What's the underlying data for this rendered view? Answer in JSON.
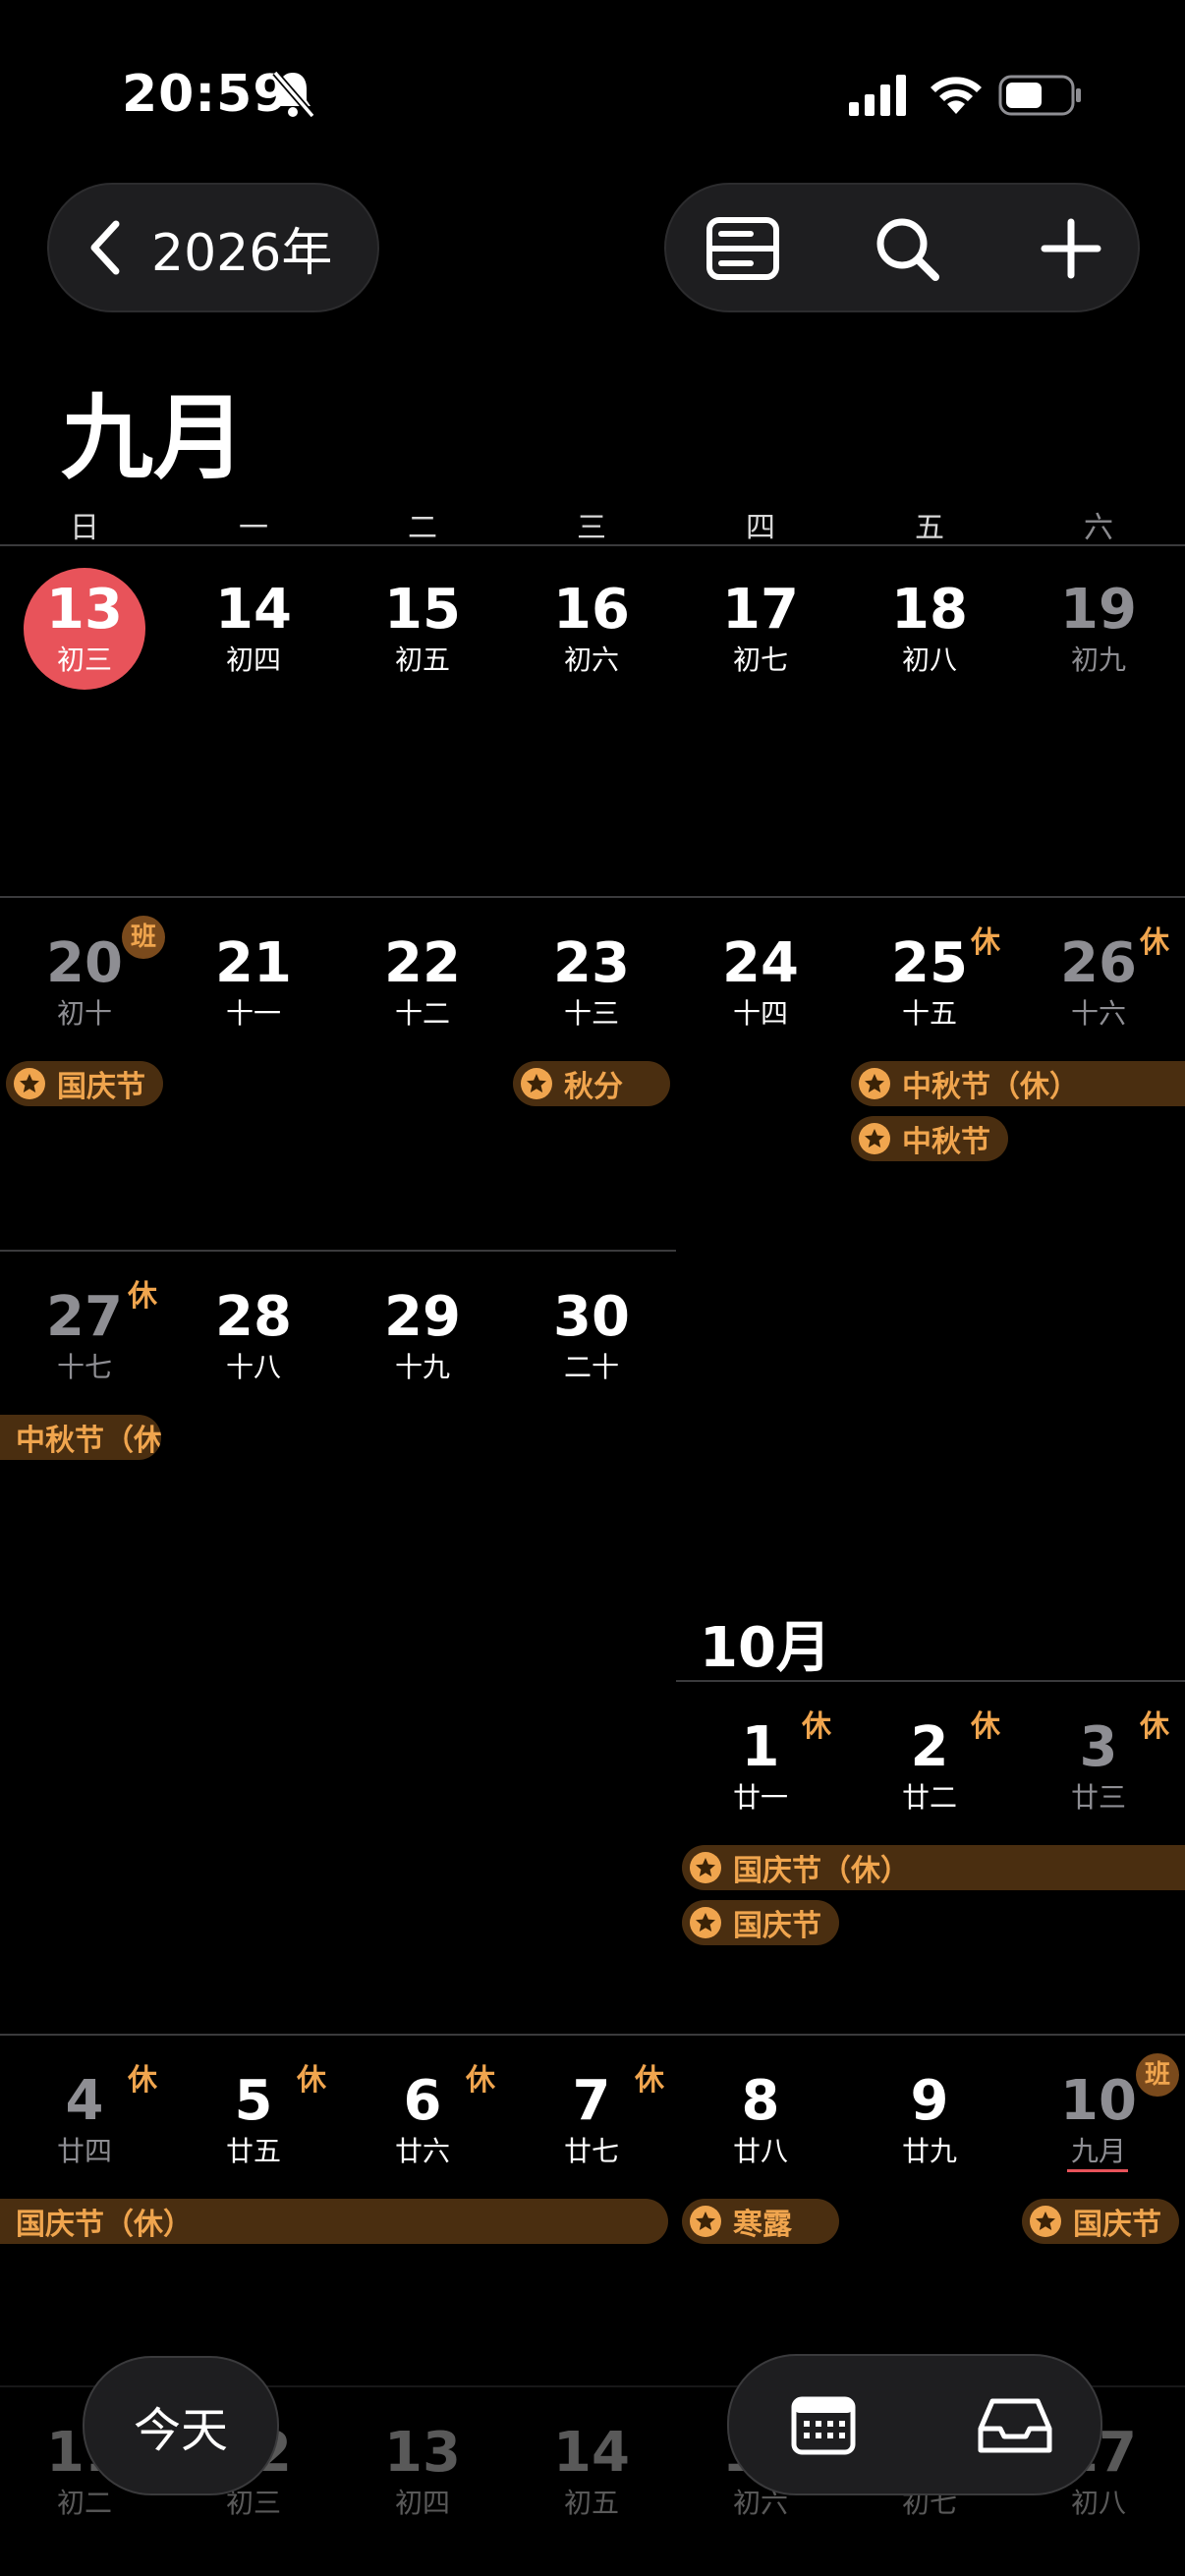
{
  "status": {
    "time": "20:59"
  },
  "header": {
    "year_label": "2026年",
    "month_title": "九月",
    "oct_title": "10月"
  },
  "weekdays": [
    "日",
    "一",
    "二",
    "三",
    "四",
    "五",
    "六"
  ],
  "week1": [
    {
      "num": "13",
      "lunar": "初三"
    },
    {
      "num": "14",
      "lunar": "初四"
    },
    {
      "num": "15",
      "lunar": "初五"
    },
    {
      "num": "16",
      "lunar": "初六"
    },
    {
      "num": "17",
      "lunar": "初七"
    },
    {
      "num": "18",
      "lunar": "初八"
    },
    {
      "num": "19",
      "lunar": "初九"
    }
  ],
  "week2": [
    {
      "num": "20",
      "lunar": "初十"
    },
    {
      "num": "21",
      "lunar": "十一"
    },
    {
      "num": "22",
      "lunar": "十二"
    },
    {
      "num": "23",
      "lunar": "十三"
    },
    {
      "num": "24",
      "lunar": "十四"
    },
    {
      "num": "25",
      "lunar": "十五"
    },
    {
      "num": "26",
      "lunar": "十六"
    }
  ],
  "week3": [
    {
      "num": "27",
      "lunar": "十七"
    },
    {
      "num": "28",
      "lunar": "十八"
    },
    {
      "num": "29",
      "lunar": "十九"
    },
    {
      "num": "30",
      "lunar": "二十"
    }
  ],
  "week4": [
    {
      "num": "1",
      "lunar": "廿一"
    },
    {
      "num": "2",
      "lunar": "廿二"
    },
    {
      "num": "3",
      "lunar": "廿三"
    }
  ],
  "week5": [
    {
      "num": "4",
      "lunar": "廿四"
    },
    {
      "num": "5",
      "lunar": "廿五"
    },
    {
      "num": "6",
      "lunar": "廿六"
    },
    {
      "num": "7",
      "lunar": "廿七"
    },
    {
      "num": "8",
      "lunar": "廿八"
    },
    {
      "num": "9",
      "lunar": "廿九"
    },
    {
      "num": "10",
      "lunar": "九月"
    }
  ],
  "week6": [
    {
      "num": "11",
      "lunar": "初二"
    },
    {
      "num": "12",
      "lunar": "初三"
    },
    {
      "num": "13",
      "lunar": "初四"
    },
    {
      "num": "14",
      "lunar": "初五"
    },
    {
      "num": "15",
      "lunar": "初六"
    },
    {
      "num": "16",
      "lunar": "初七"
    },
    {
      "num": "17",
      "lunar": "初八"
    }
  ],
  "badges": {
    "ban": "班",
    "xiu": "休"
  },
  "events": {
    "guoqing": "国庆节",
    "qiufen": "秋分",
    "zhongqiu_xiu": "中秋节（休）",
    "zhongqiu": "中秋节",
    "zhongqiu_cut": "中秋节（休",
    "guoqing_xiu": "国庆节（休）",
    "hanlu": "寒露"
  },
  "bottom": {
    "today_label": "今天"
  },
  "colors": {
    "accent": "#f0a54e",
    "today": "#e8535a",
    "background": "#000000"
  }
}
